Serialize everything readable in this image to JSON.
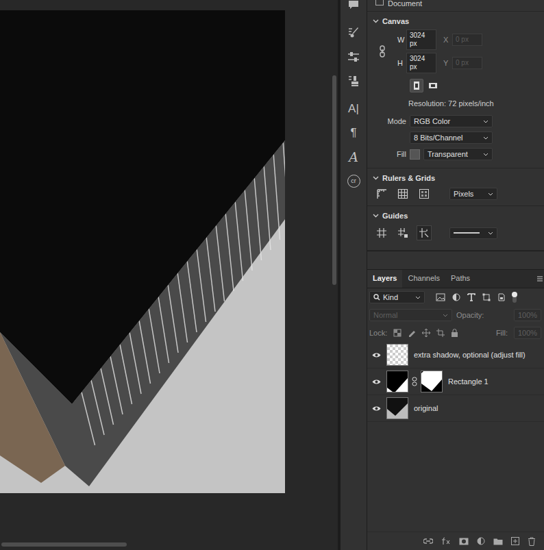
{
  "properties": {
    "document_label": "Document",
    "canvas": {
      "title": "Canvas",
      "expanded": true,
      "linked": true,
      "fields": [
        {
          "label": "W",
          "value": "3024 px",
          "disabled": false
        },
        {
          "label": "X",
          "value": "0 px",
          "disabled": true
        },
        {
          "label": "H",
          "value": "3024 px",
          "disabled": false
        },
        {
          "label": "Y",
          "value": "0 px",
          "disabled": true
        }
      ],
      "orientation": [
        {
          "kind": "portrait",
          "selected": true
        },
        {
          "kind": "landscape",
          "selected": false
        }
      ],
      "resolution": "Resolution: 72 pixels/inch",
      "mode_label": "Mode",
      "mode": "RGB Color",
      "depth": "8 Bits/Channel",
      "fill_label": "Fill",
      "fill": "Transparent"
    },
    "rulers": {
      "title": "Rulers & Grids",
      "expanded": true,
      "units": "Pixels"
    },
    "guides": {
      "title": "Guides",
      "expanded": true
    }
  },
  "toolbar": [
    {
      "kind": "comment",
      "glyph": ""
    },
    {
      "kind": "brushes",
      "glyph": ""
    },
    {
      "kind": "adjust",
      "glyph": ""
    },
    {
      "kind": "stamp",
      "glyph": ""
    },
    {
      "kind": "glyph",
      "glyph": "A|"
    },
    {
      "kind": "glyph",
      "glyph": "¶"
    },
    {
      "kind": "script",
      "glyph": "A"
    },
    {
      "kind": "badge",
      "glyph": "cr"
    }
  ],
  "layers_panel": {
    "tabs": [
      {
        "label": "Layers",
        "selected": true
      },
      {
        "label": "Channels",
        "selected": false
      },
      {
        "label": "Paths",
        "selected": false
      }
    ],
    "filter": "Kind",
    "blend_mode": "Normal",
    "opacity_label": "Opacity:",
    "opacity": "100%",
    "lock_label": "Lock:",
    "fill_label": "Fill:",
    "fill": "100%",
    "controls_disabled": true,
    "layers": [
      {
        "name": "extra shadow, optional (adjust fill)",
        "visible": true,
        "kind": "transparent",
        "selected": false
      },
      {
        "name": "Rectangle 1",
        "visible": true,
        "kind": "shape",
        "selected": false
      },
      {
        "name": "original",
        "visible": true,
        "kind": "image",
        "selected": false
      }
    ]
  }
}
